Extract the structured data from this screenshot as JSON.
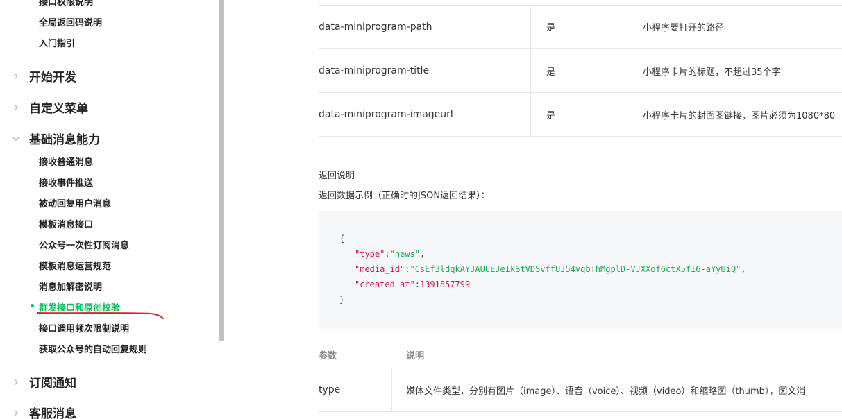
{
  "sidebar": {
    "top_items": [
      "接口权限说明",
      "全局返回码说明",
      "入门指引"
    ],
    "categories": {
      "start_dev": "开始开发",
      "custom_menu": "自定义菜单",
      "basic_message": "基础消息能力",
      "subscribe_notify": "订阅通知",
      "customer_service": "客服消息"
    },
    "basic_message_items": [
      "接收普通消息",
      "接收事件推送",
      "被动回复用户消息",
      "模板消息接口",
      "公众号一次性订阅消息",
      "模板消息运营规范",
      "消息加解密说明",
      "群发接口和原创校验",
      "接口调用频次限制说明",
      "获取公众号的自动回复规则"
    ],
    "active_item": "群发接口和原创校验",
    "colors": {
      "active": "#07c160",
      "underline": "#e02020"
    }
  },
  "param_table": {
    "rows": [
      {
        "name": "data-miniprogram-path",
        "required": "是",
        "desc": "小程序要打开的路径"
      },
      {
        "name": "data-miniprogram-title",
        "required": "是",
        "desc": "小程序卡片的标题，不超过35个字"
      },
      {
        "name": "data-miniprogram-imageurl",
        "required": "是",
        "desc": "小程序卡片的封面图链接，图片必须为1080*80"
      }
    ]
  },
  "return_section": {
    "title": "返回说明",
    "example_label": "返回数据示例（正确时的JSON返回结果）："
  },
  "code": {
    "open": "{",
    "close": "}",
    "lines": [
      {
        "key": "\"type\"",
        "sep": ":",
        "value": "\"news\"",
        "tail": ","
      },
      {
        "key": "\"media_id\"",
        "sep": ":",
        "value": "\"CsEf3ldqkAYJAU6EJeIkStVDSvffUJ54vqbThMgplD-VJXXof6ctX5fI6-aYyUiQ\"",
        "tail": ","
      },
      {
        "key": "\"created_at\"",
        "sep": ":",
        "value": "1391857799",
        "tail": ""
      }
    ]
  },
  "response_table": {
    "headers": [
      "参数",
      "说明"
    ],
    "rows": [
      {
        "name": "type",
        "desc": "媒体文件类型，分别有图片（image）、语音（voice）、视频（video）和缩略图（thumb），图文消"
      }
    ]
  }
}
